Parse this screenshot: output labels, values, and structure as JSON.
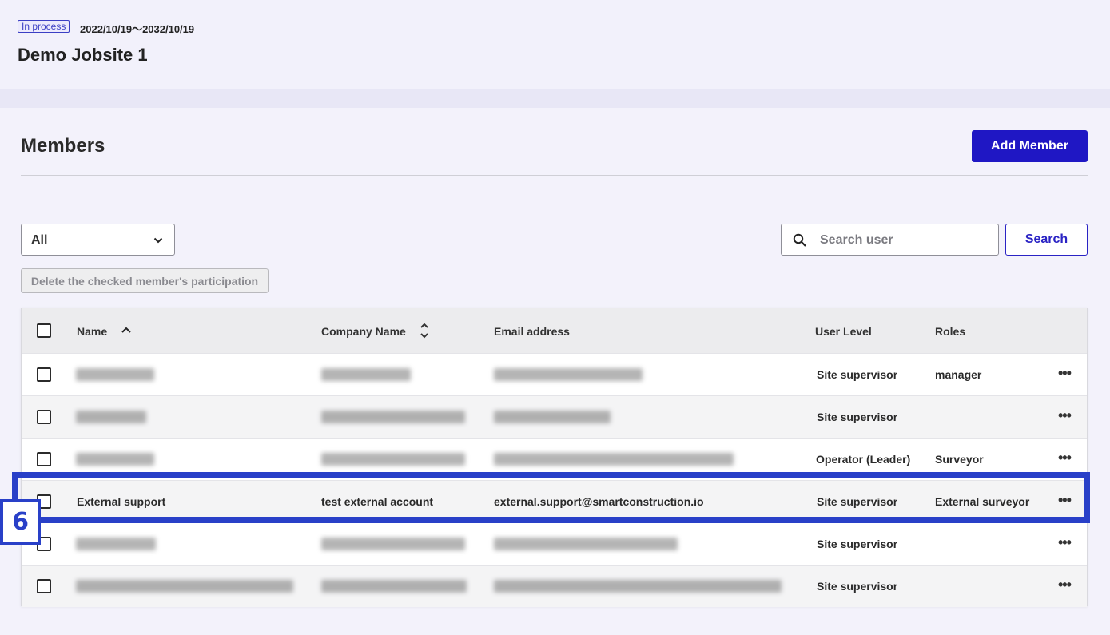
{
  "jobsite": {
    "status": "In process",
    "date_range": "2022/10/19～2032/10/19",
    "title": "Demo Jobsite 1"
  },
  "members": {
    "heading": "Members",
    "add_button": "Add Member",
    "filter": {
      "selected": "All"
    },
    "search": {
      "placeholder": "Search user",
      "button": "Search"
    },
    "delete_button": "Delete the checked member's participation",
    "columns": {
      "name": "Name",
      "company": "Company Name",
      "email": "Email address",
      "level": "User Level",
      "roles": "Roles"
    },
    "rows": [
      {
        "name": "",
        "company": "",
        "email": "",
        "level": "Site supervisor",
        "roles": "manager",
        "obscured": true
      },
      {
        "name": "",
        "company": "",
        "email": "",
        "level": "Site supervisor",
        "roles": "",
        "obscured": true
      },
      {
        "name": "",
        "company": "",
        "email": "",
        "level": "Operator (Leader)",
        "roles": "Surveyor",
        "obscured": true
      },
      {
        "name": "External support",
        "company": "test external account",
        "email": "external.support@smartconstruction.io",
        "level": "Site supervisor",
        "roles": "External surveyor",
        "obscured": false
      },
      {
        "name": "",
        "company": "",
        "email": "",
        "level": "Site supervisor",
        "roles": "",
        "obscured": true
      },
      {
        "name": "",
        "company": "",
        "email": "",
        "level": "Site supervisor",
        "roles": "",
        "obscured": true
      }
    ],
    "row_menu_glyph": "•••"
  },
  "annotation": {
    "number": "6",
    "color": "#2940c8"
  },
  "colors": {
    "accent": "#1f17c4",
    "status": "#3b3fc4"
  },
  "icons": {
    "sort_asc": "chevron-up-icon",
    "sort_both": "sort-icon",
    "dropdown": "chevron-down-icon",
    "search": "search-icon",
    "more": "more-horizontal-icon"
  }
}
